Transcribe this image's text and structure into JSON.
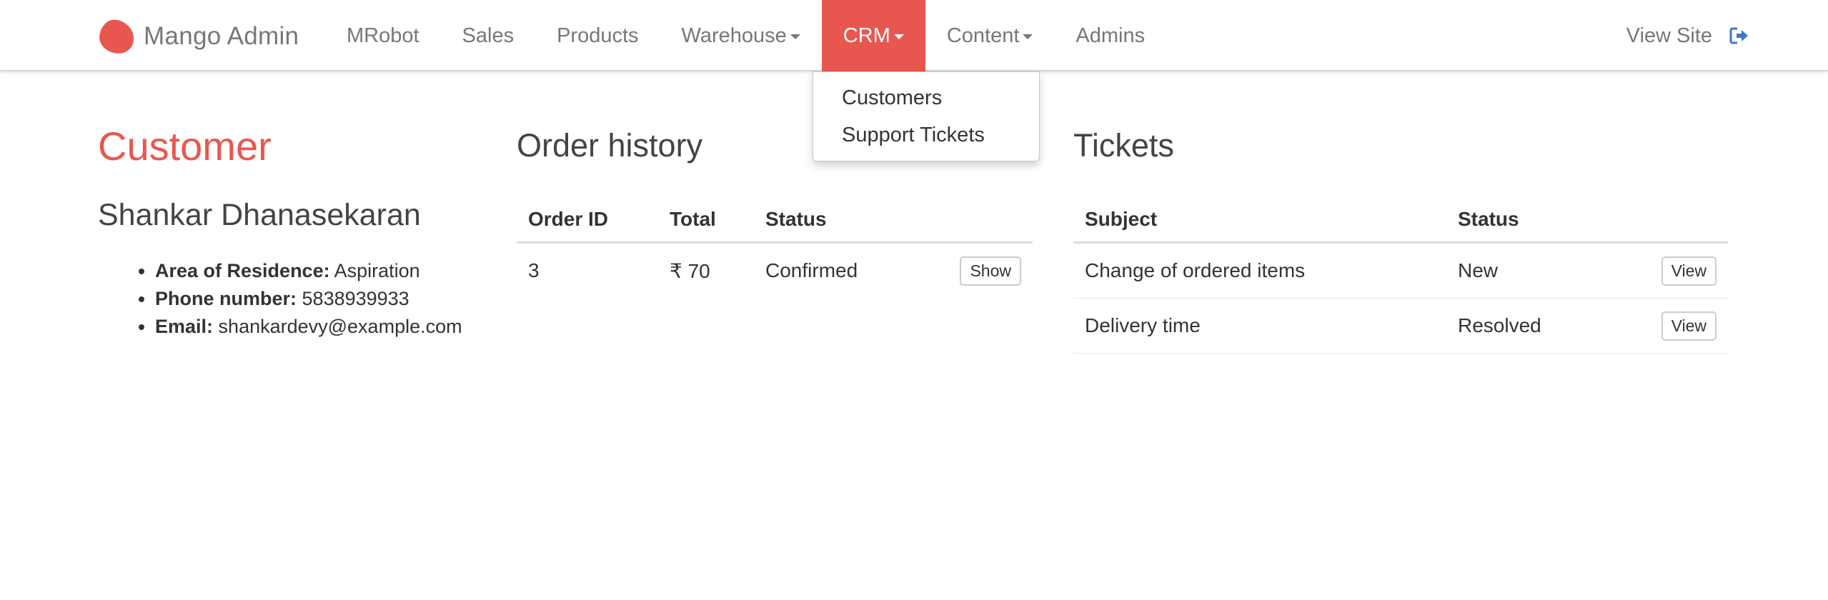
{
  "brand": {
    "name": "Mango Admin",
    "logo_icon": "mango-logo-icon",
    "accent": "#e8574f"
  },
  "nav": {
    "items": [
      {
        "label": "MRobot"
      },
      {
        "label": "Sales"
      },
      {
        "label": "Products"
      },
      {
        "label": "Warehouse"
      },
      {
        "label": "CRM"
      },
      {
        "label": "Content"
      },
      {
        "label": "Admins"
      }
    ],
    "view_site": "View Site",
    "signout_icon": "sign-out-icon"
  },
  "dropdown": {
    "items": [
      "Customers",
      "Support Tickets"
    ]
  },
  "customer": {
    "title": "Customer",
    "name": "Shankar Dhanasekaran",
    "details": [
      {
        "label": "Area of Residence:",
        "value": "Aspiration"
      },
      {
        "label": "Phone number:",
        "value": "5838939933"
      },
      {
        "label": "Email:",
        "value": "shankardevy@example.com"
      }
    ]
  },
  "orders": {
    "title": "Order history",
    "columns": [
      "Order ID",
      "Total",
      "Status"
    ],
    "rows": [
      {
        "id": "3",
        "total": "₹ 70",
        "status": "Confirmed",
        "action": "Show"
      }
    ]
  },
  "tickets": {
    "title": "Tickets",
    "columns": [
      "Subject",
      "Status"
    ],
    "rows": [
      {
        "subject": "Change of ordered items",
        "status": "New",
        "action": "View"
      },
      {
        "subject": "Delivery time",
        "status": "Resolved",
        "action": "View"
      }
    ]
  }
}
